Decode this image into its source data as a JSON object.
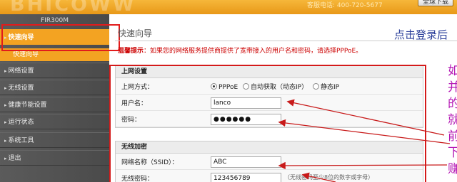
{
  "header": {
    "logo": "BHICOWW",
    "hotline_label": "客服电话:",
    "hotline_number": "400-720-5677",
    "top_button": "全球下载"
  },
  "sidebar": {
    "model": "FIR300M",
    "items": [
      {
        "label": "快速向导",
        "active": true
      },
      {
        "label": "网络设置"
      },
      {
        "label": "无线设置"
      },
      {
        "label": "健康节能设置"
      },
      {
        "label": "运行状态"
      },
      {
        "label": "系统工具"
      },
      {
        "label": "退出"
      }
    ],
    "sub_item": "快速向导"
  },
  "main": {
    "title": "快速向导",
    "login_hint": "点击登录后",
    "tip_prefix": "温馨提示",
    "tip_text": "：如果您的网络服务提供商提供了宽带接入的用户名和密码，请选择PPPoE。"
  },
  "wan": {
    "heading": "上网设置",
    "mode_label": "上网方式：",
    "mode_options": [
      "PPPoE",
      "自动获取（动态IP）",
      "静态IP"
    ],
    "username_label": "用户名：",
    "username_value": "lanco",
    "password_label": "密码：",
    "password_value": "●●●●●●"
  },
  "wireless": {
    "heading": "无线加密",
    "ssid_label": "网络名称（SSID）：",
    "ssid_value": "ABC",
    "key_label": "无线密码：",
    "key_value": "123456789",
    "key_hint": "（无线密码至少8位的数字或字母）"
  },
  "annotation": [
    "如",
    "并",
    "的",
    "就",
    "前",
    "下",
    "赚"
  ],
  "colors": {
    "header_orange": "#f0a62a",
    "sidebar_gray": "#555555",
    "highlight_red": "#e21b1b",
    "annotation_purple": "#b418b4",
    "login_blue": "#2a3e9a"
  }
}
